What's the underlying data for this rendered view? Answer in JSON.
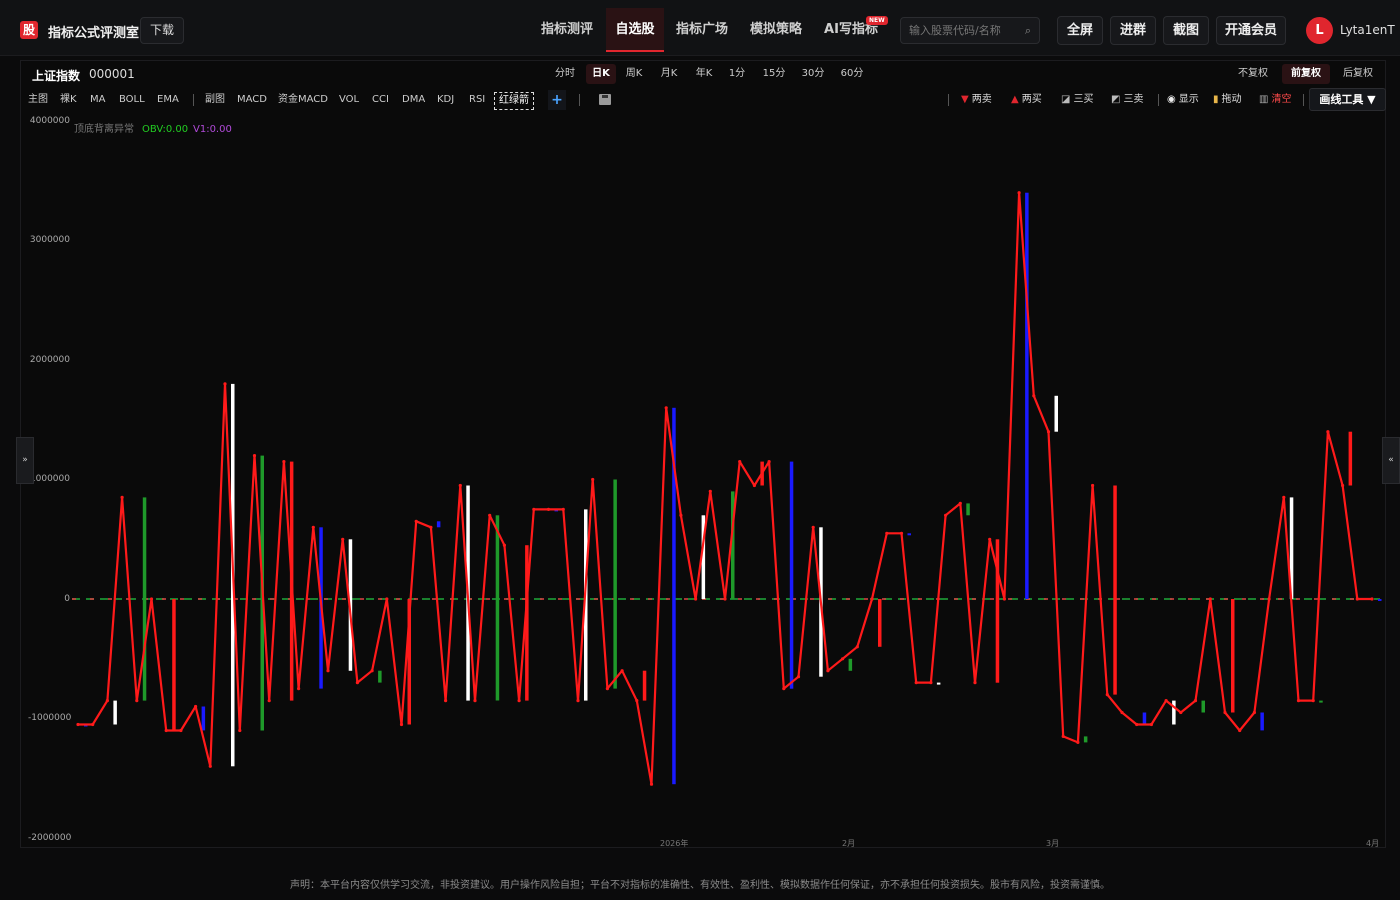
{
  "header": {
    "logo_char": "股",
    "brand": "指标公式评测室",
    "download": "下载",
    "nav": [
      "指标测评",
      "自选股",
      "指标广场",
      "模拟策略",
      "AI写指标"
    ],
    "nav_active": 1,
    "new_badge": "NEW",
    "search_placeholder": "输入股票代码/名称",
    "buttons": [
      "全屏",
      "进群",
      "截图",
      "开通会员"
    ],
    "avatar_letter": "L",
    "username": "Lyta1enT"
  },
  "symbol": {
    "name": "上证指数",
    "code": "000001"
  },
  "periods": [
    "分时",
    "日K",
    "周K",
    "月K",
    "年K",
    "1分",
    "15分",
    "30分",
    "60分"
  ],
  "period_active": 1,
  "adjust": [
    "不复权",
    "前复权",
    "后复权"
  ],
  "adjust_active": 1,
  "indicators": [
    "主图",
    "裸K",
    "MA",
    "BOLL",
    "EMA",
    "副图",
    "MACD",
    "资金MACD",
    "VOL",
    "CCI",
    "DMA",
    "KDJ",
    "RSI",
    "红绿箭"
  ],
  "tools": {
    "two_sell": "两卖",
    "two_buy": "两买",
    "three_buy": "三买",
    "three_sell": "三卖",
    "show": "显示",
    "drag": "拖动",
    "clear": "清空",
    "draw_tool": "画线工具 ▼"
  },
  "collapse": {
    "left": "»",
    "right": "«"
  },
  "disclaimer": "声明：本平台内容仅供学习交流，非投资建议。用户操作风险自担；平台不对指标的准确性、有效性、盈利性、模拟数据作任何保证，亦不承担任何投资损失。股市有风险，投资需谨慎。",
  "chart_data": {
    "type": "line",
    "indicator_labels": {
      "name": "顶底背离异常",
      "obv": "OBV:0.00",
      "v1": "V1:0.00"
    },
    "y_ticks": [
      "4000000",
      "3000000",
      "2000000",
      "1000000",
      "0",
      "-1000000",
      "-2000000"
    ],
    "ylim": [
      -2000000,
      4000000
    ],
    "x_ticks": [
      "2026年",
      "2月",
      "3月",
      "4月"
    ],
    "series": [
      {
        "values": [
          -1050000,
          -1050000,
          -850000,
          850000,
          -850000,
          0,
          -1100000,
          -1100000,
          -900000,
          -1400000,
          1800000,
          -1100000,
          1200000,
          -850000,
          1150000,
          -750000,
          600000,
          -600000,
          500000,
          -700000,
          -600000,
          0,
          -1050000,
          650000,
          600000,
          -850000,
          950000,
          -850000,
          700000,
          450000,
          -850000,
          750000,
          750000,
          750000,
          -850000,
          1000000,
          -750000,
          -600000,
          -850000,
          -1550000,
          1600000,
          700000,
          0,
          900000,
          0,
          1150000,
          950000,
          1150000,
          -750000,
          -650000,
          600000,
          -600000,
          -500000,
          -400000,
          0,
          550000,
          550000,
          -700000,
          -700000,
          700000,
          800000,
          -700000,
          500000,
          0,
          3400000,
          1700000,
          1400000,
          -1150000,
          -1200000,
          950000,
          -800000,
          -950000,
          -1050000,
          -1050000,
          -850000,
          -950000,
          -850000,
          0,
          -950000,
          -1100000,
          -950000,
          0,
          850000,
          -850000,
          -850000,
          1400000,
          950000,
          0,
          0
        ]
      }
    ]
  }
}
